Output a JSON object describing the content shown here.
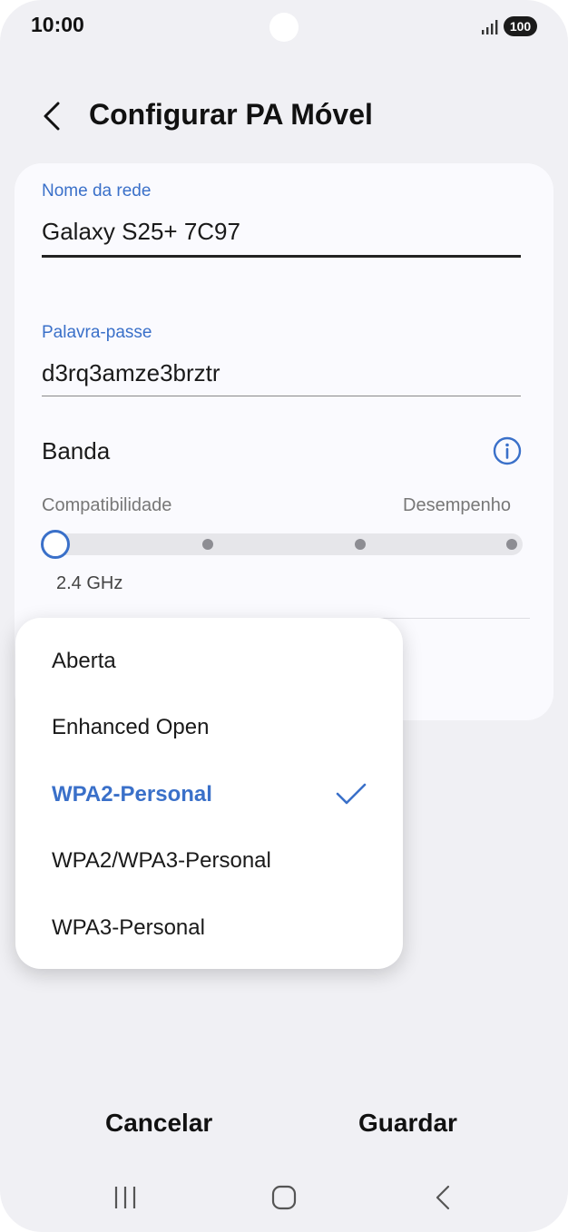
{
  "status_bar": {
    "time": "10:00",
    "battery": "100"
  },
  "header": {
    "title": "Configurar PA Móvel"
  },
  "form": {
    "network_name_label": "Nome da rede",
    "network_name_value": "Galaxy S25+ 7C97",
    "password_label": "Palavra-passe",
    "password_value": "d3rq3amze3brztr",
    "band_label": "Banda",
    "band_scale_left": "Compatibilidade",
    "band_scale_right": "Desempenho",
    "band_value": "2.4 GHz",
    "band_slider_position": 0
  },
  "security_dropdown": {
    "options": [
      "Aberta",
      "Enhanced Open",
      "WPA2-Personal",
      "WPA2/WPA3-Personal",
      "WPA3-Personal"
    ],
    "selected": "WPA2-Personal"
  },
  "actions": {
    "cancel_label": "Cancelar",
    "save_label": "Guardar"
  },
  "colors": {
    "accent": "#3a70c9",
    "background": "#f0f0f4",
    "card": "#fafafe"
  },
  "icons": {
    "back": "chevron-left-icon",
    "info": "info-icon",
    "check": "check-icon",
    "nav_recents": "recents-icon",
    "nav_home": "home-icon",
    "nav_back": "nav-back-icon"
  }
}
